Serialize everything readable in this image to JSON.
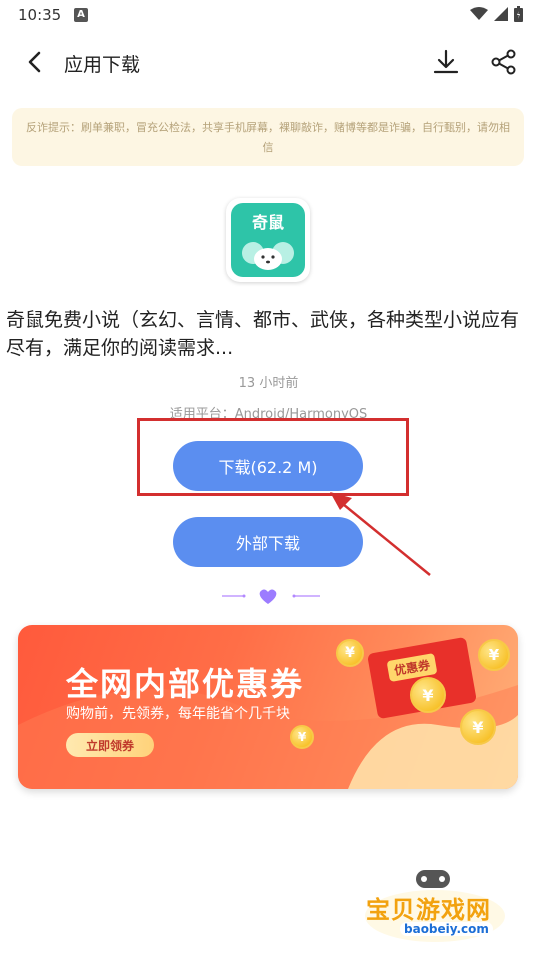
{
  "status_bar": {
    "time": "10:35"
  },
  "nav": {
    "title": "应用下载"
  },
  "notice": {
    "text": "反诈提示：刷单兼职，冒充公检法，共享手机屏幕，裸聊敲诈，赌博等都是诈骗，自行甄别，请勿相信"
  },
  "app": {
    "icon_text": "奇鼠",
    "description": "奇鼠免费小说（玄幻、言情、都市、武侠，各种类型小说应有尽有，满足你的阅读需求...",
    "updated": "13 小时前",
    "platform": "适用平台：Android/HarmonyOS"
  },
  "buttons": {
    "download": "下载(62.2 M)",
    "external": "外部下载"
  },
  "banner": {
    "title": "全网内部优惠券",
    "subtitle": "购物前，先领券，每年能省个几千块",
    "cta": "立即领券",
    "coupon_label": "优惠券",
    "coin_symbol": "¥"
  },
  "watermark": {
    "title": "宝贝游戏网",
    "url": "baobeiy.com"
  },
  "colors": {
    "button_blue": "#5b8ef0",
    "highlight_red": "#d32f2f",
    "notice_bg": "#fdf6e3",
    "app_green": "#2ec4a8"
  }
}
